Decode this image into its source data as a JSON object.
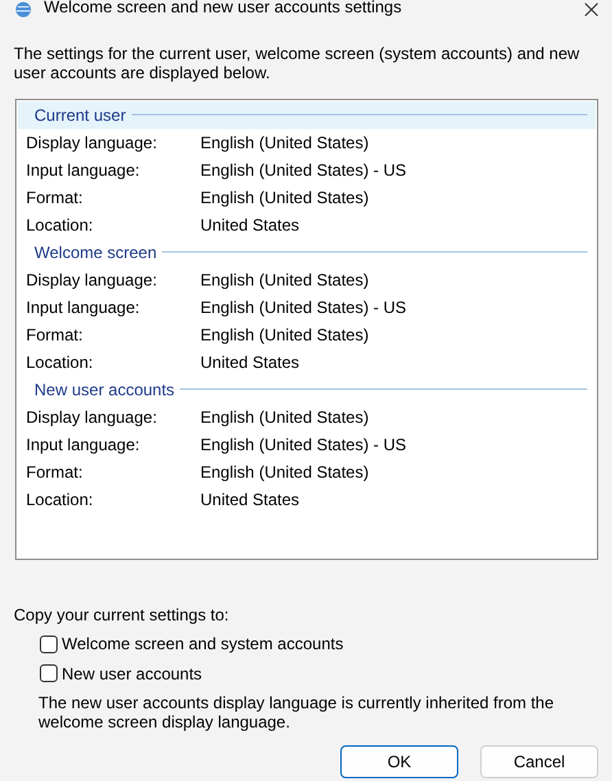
{
  "window": {
    "title": "Welcome screen and new user accounts settings"
  },
  "intro": "The settings for the current user, welcome screen (system accounts) and new user accounts are displayed below.",
  "sections": [
    {
      "title": "Current user",
      "selected": true,
      "rows": [
        {
          "label": "Display language:",
          "value": "English (United States)"
        },
        {
          "label": "Input language:",
          "value": "English (United States) - US"
        },
        {
          "label": "Format:",
          "value": "English (United States)"
        },
        {
          "label": "Location:",
          "value": "United States"
        }
      ]
    },
    {
      "title": "Welcome screen",
      "selected": false,
      "rows": [
        {
          "label": "Display language:",
          "value": "English (United States)"
        },
        {
          "label": "Input language:",
          "value": "English (United States) - US"
        },
        {
          "label": "Format:",
          "value": "English (United States)"
        },
        {
          "label": "Location:",
          "value": "United States"
        }
      ]
    },
    {
      "title": "New user accounts",
      "selected": false,
      "rows": [
        {
          "label": "Display language:",
          "value": "English (United States)"
        },
        {
          "label": "Input language:",
          "value": "English (United States) - US"
        },
        {
          "label": "Format:",
          "value": "English (United States)"
        },
        {
          "label": "Location:",
          "value": "United States"
        }
      ]
    }
  ],
  "copy_label": "Copy your current settings to:",
  "checkboxes": [
    {
      "label": "Welcome screen and system accounts",
      "checked": false
    },
    {
      "label": "New user accounts",
      "checked": false
    }
  ],
  "note": "The new user accounts display language is currently inherited from the welcome screen display language.",
  "buttons": [
    {
      "label": "OK",
      "kind": "default"
    },
    {
      "label": "Cancel",
      "kind": "normal"
    }
  ]
}
